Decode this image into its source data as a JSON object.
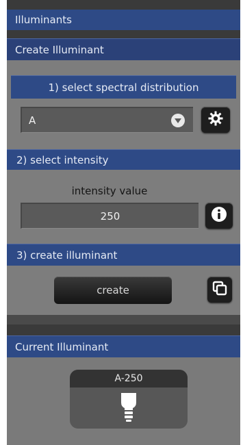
{
  "header": {
    "title": "Illuminants"
  },
  "create_section": {
    "title": "Create Illuminant",
    "step1": {
      "label": "1) select spectral distribution",
      "selected_value": "A"
    },
    "step2": {
      "label": "2) select intensity",
      "intensity_label": "intensity value",
      "intensity_value": "250"
    },
    "step3": {
      "label": "3) create illuminant",
      "create_button": "create"
    }
  },
  "current_section": {
    "title": "Current Illuminant",
    "card_label": "A-250"
  },
  "colors": {
    "header_blue": "#2e4a86",
    "panel_dark": "#3a3a3a",
    "section_gray": "#7d7d7d",
    "button_black": "#1e1e1e"
  },
  "icons": {
    "dropdown": "chevron-down-icon",
    "settings": "gear-icon",
    "info": "info-icon",
    "copy": "copy-icon",
    "bulb": "lightbulb-icon"
  }
}
